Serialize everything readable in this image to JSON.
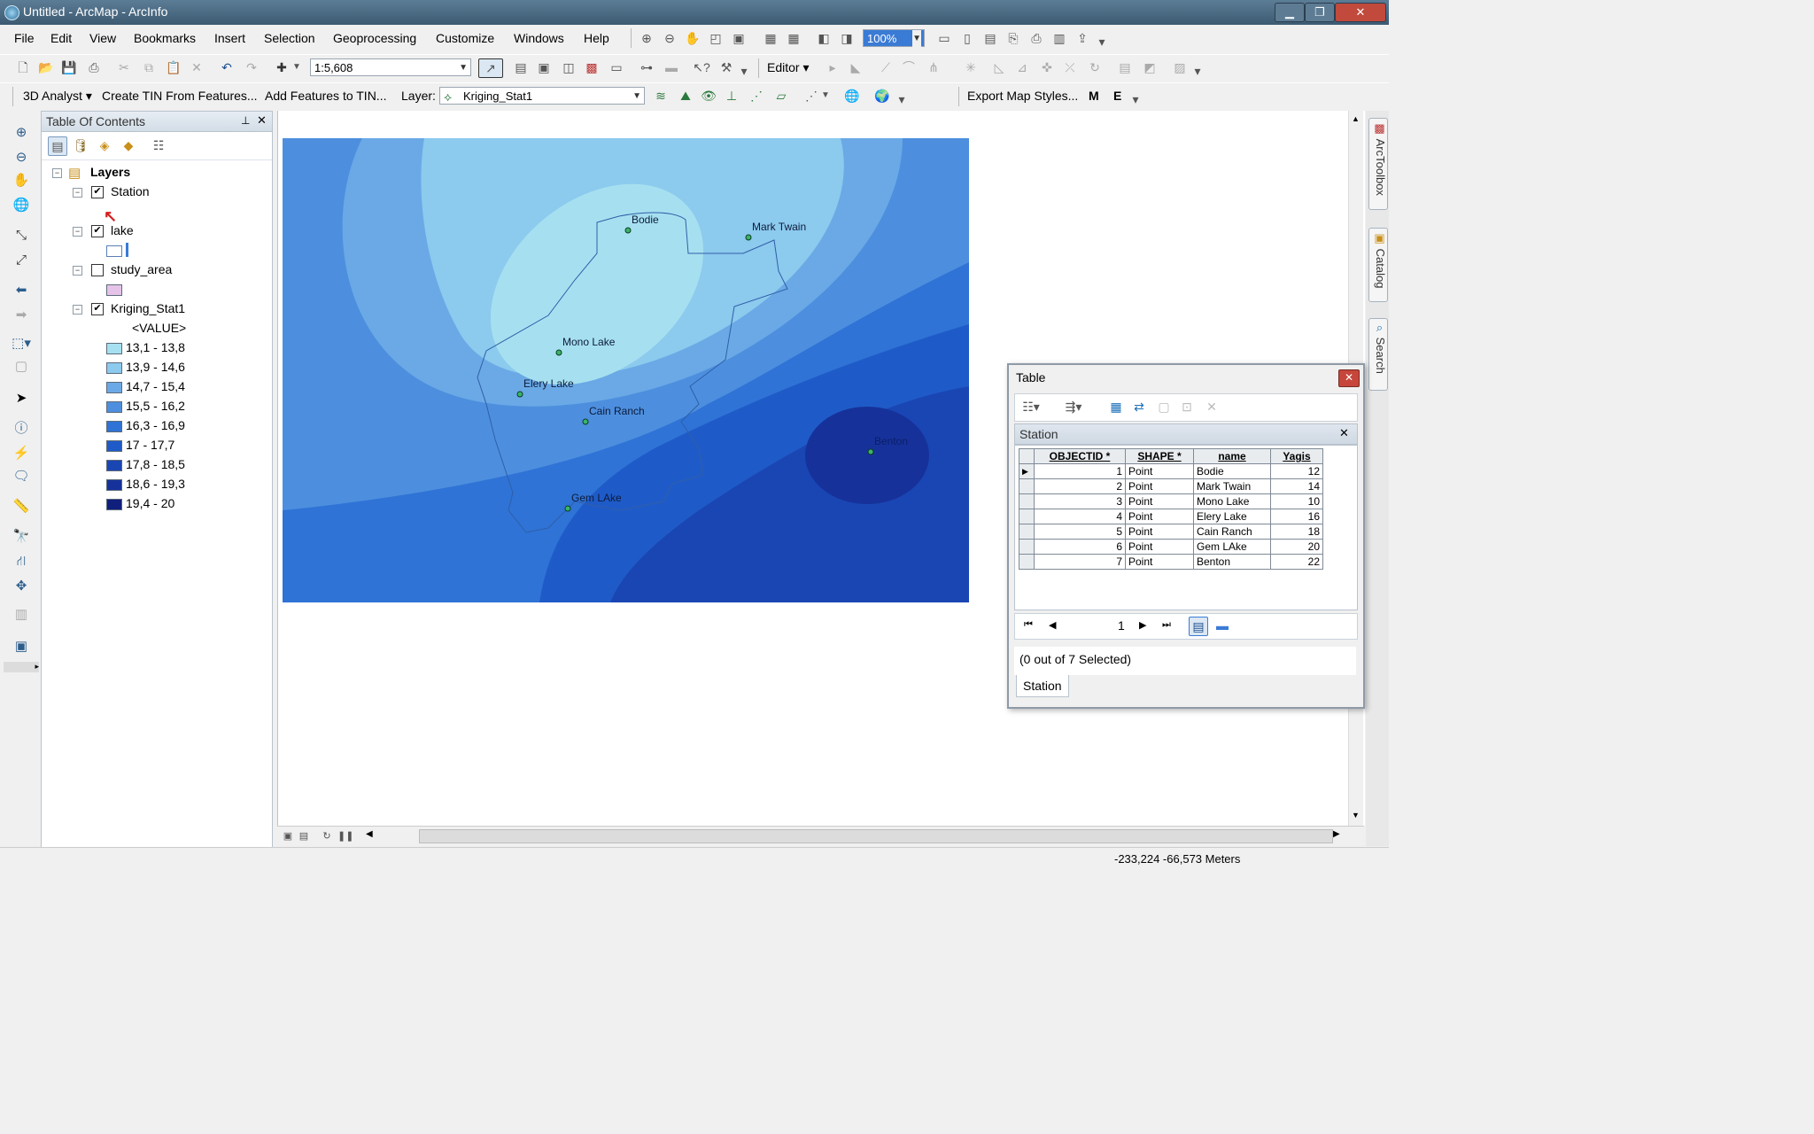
{
  "window": {
    "title": "Untitled - ArcMap - ArcInfo",
    "minimize": "▁",
    "restore": "❐",
    "close": "✕"
  },
  "menu": [
    "File",
    "Edit",
    "View",
    "Bookmarks",
    "Insert",
    "Selection",
    "Geoprocessing",
    "Customize",
    "Windows",
    "Help"
  ],
  "standard_toolbar": {
    "scale": "1:5,608",
    "zoom_percent": "100%"
  },
  "editor_label": "Editor ▾",
  "analyst_toolbar": {
    "analyst_label": "3D Analyst ▾",
    "create_tin": "Create TIN From Features...",
    "add_features": "Add Features to TIN...",
    "layer_label": "Layer:",
    "layer_value": "Kriging_Stat1",
    "export_styles": "Export Map Styles...",
    "m_label": "M",
    "e_label": "E"
  },
  "toc": {
    "title": "Table Of Contents",
    "pin": "⊥",
    "close": "✕",
    "root": "Layers",
    "layers": [
      {
        "name": "Station",
        "checked": "✔"
      },
      {
        "name": "lake",
        "checked": "✔"
      },
      {
        "name": "study_area",
        "checked": ""
      },
      {
        "name": "Kriging_Stat1",
        "checked": "✔"
      }
    ],
    "value_header": "<VALUE>",
    "legend": [
      {
        "label": "13,1 - 13,8",
        "color": "#a6e0f0"
      },
      {
        "label": "13,9 - 14,6",
        "color": "#8ccaee"
      },
      {
        "label": "14,7 - 15,4",
        "color": "#6aa9e6"
      },
      {
        "label": "15,5 - 16,2",
        "color": "#4d8fde"
      },
      {
        "label": "16,3 - 16,9",
        "color": "#2f73d6"
      },
      {
        "label": "17 - 17,7",
        "color": "#1f5bc8"
      },
      {
        "label": "17,8 - 18,5",
        "color": "#1a46b4"
      },
      {
        "label": "18,6 - 19,3",
        "color": "#16329a"
      },
      {
        "label": "19,4 - 20",
        "color": "#101f7c"
      }
    ],
    "lake_color": "#ffffff",
    "study_area_color": "#e5c3e8"
  },
  "map": {
    "stations": [
      {
        "name": "Bodie"
      },
      {
        "name": "Mark Twain"
      },
      {
        "name": "Mono Lake"
      },
      {
        "name": "Elery Lake"
      },
      {
        "name": "Cain Ranch"
      },
      {
        "name": "Gem LAke"
      },
      {
        "name": "Benton"
      }
    ]
  },
  "dock": {
    "toolbox": "ArcToolbox",
    "catalog": "Catalog",
    "search": "Search"
  },
  "statusbar": {
    "coords": "-233,224  -66,573 Meters"
  },
  "table_window": {
    "title": "Table",
    "close": "✕",
    "table_name": "Station",
    "columns": [
      "OBJECTID *",
      "SHAPE *",
      "name",
      "Yagis"
    ],
    "rows": [
      [
        "1",
        "Point",
        "Bodie",
        "12"
      ],
      [
        "2",
        "Point",
        "Mark Twain",
        "14"
      ],
      [
        "3",
        "Point",
        "Mono Lake",
        "10"
      ],
      [
        "4",
        "Point",
        "Elery Lake",
        "16"
      ],
      [
        "5",
        "Point",
        "Cain Ranch",
        "18"
      ],
      [
        "6",
        "Point",
        "Gem LAke",
        "20"
      ],
      [
        "7",
        "Point",
        "Benton",
        "22"
      ]
    ],
    "page": "1",
    "status": "(0 out of 7 Selected)",
    "tab": "Station"
  }
}
